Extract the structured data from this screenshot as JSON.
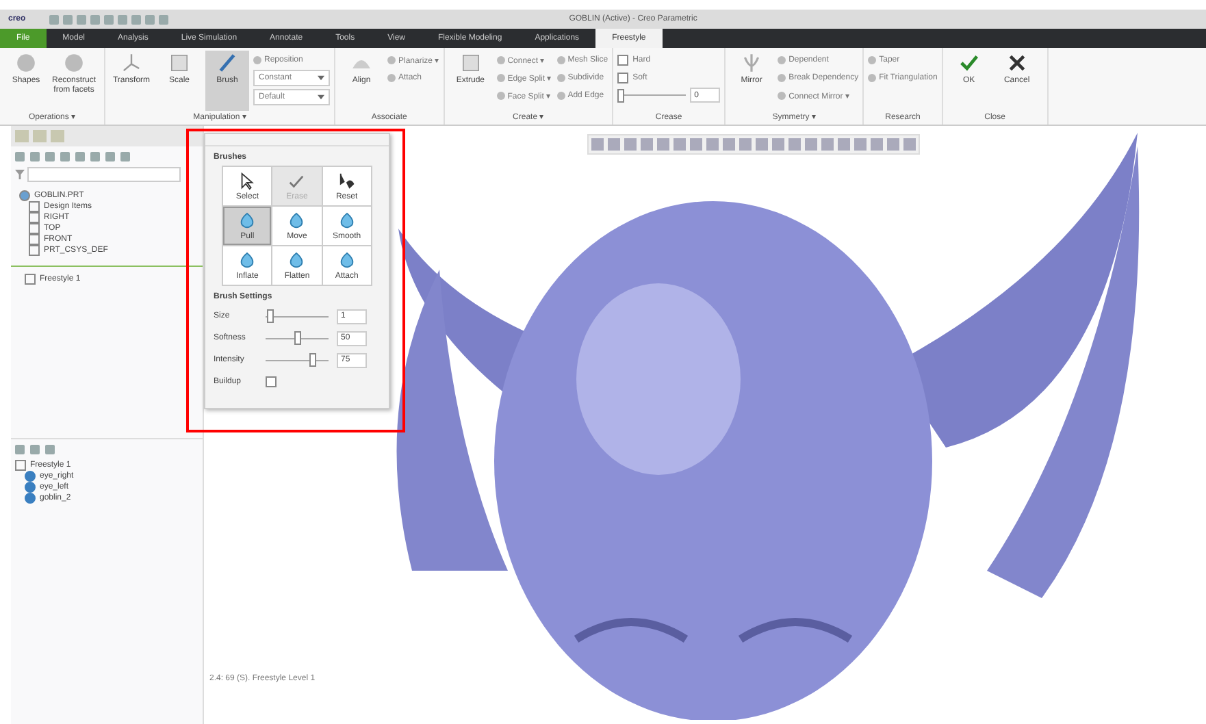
{
  "app": {
    "logo": "creo",
    "title": "GOBLIN (Active) - Creo Parametric"
  },
  "tabs": [
    {
      "label": "File",
      "selected": false
    },
    {
      "label": "Model",
      "selected": false
    },
    {
      "label": "Analysis",
      "selected": false
    },
    {
      "label": "Live Simulation",
      "selected": false
    },
    {
      "label": "Annotate",
      "selected": false
    },
    {
      "label": "Tools",
      "selected": false
    },
    {
      "label": "View",
      "selected": false
    },
    {
      "label": "Flexible Modeling",
      "selected": false
    },
    {
      "label": "Applications",
      "selected": false
    },
    {
      "label": "Freestyle",
      "selected": true
    }
  ],
  "ribbon": [
    {
      "label": "Operations ▾",
      "items": [
        {
          "kind": "large",
          "label": "Shapes",
          "selected": false
        },
        {
          "kind": "large",
          "label": "Reconstruct from facets",
          "selected": false
        }
      ]
    },
    {
      "label": "Manipulation ▾",
      "items": [
        {
          "kind": "large",
          "label": "Transform",
          "selected": false
        },
        {
          "kind": "large",
          "label": "Scale",
          "selected": false
        },
        {
          "kind": "large",
          "label": "Brush",
          "selected": true
        },
        {
          "kind": "small",
          "label": "Reposition"
        },
        {
          "kind": "dropdown",
          "label": "Constant"
        },
        {
          "kind": "dropdown",
          "label": "Default"
        }
      ]
    },
    {
      "label": "Associate",
      "items": [
        {
          "kind": "large",
          "label": "Align",
          "selected": false
        },
        {
          "kind": "small",
          "label": "Planarize ▾"
        },
        {
          "kind": "small",
          "label": "Attach"
        }
      ]
    },
    {
      "label": "Create ▾",
      "items": [
        {
          "kind": "large",
          "label": "Extrude",
          "selected": false
        },
        {
          "kind": "small",
          "label": "Connect ▾"
        },
        {
          "kind": "small",
          "label": "Edge Split ▾"
        },
        {
          "kind": "small",
          "label": "Face Split ▾"
        },
        {
          "kind": "small",
          "label": "Mesh Slice"
        },
        {
          "kind": "small",
          "label": "Subdivide"
        },
        {
          "kind": "small",
          "label": "Add Edge"
        }
      ]
    },
    {
      "label": "Crease",
      "items": [
        {
          "kind": "check",
          "label": "Hard",
          "checked": false
        },
        {
          "kind": "check",
          "label": "Soft",
          "checked": false
        },
        {
          "kind": "slider",
          "level": 0,
          "value": "0"
        }
      ]
    },
    {
      "label": "Symmetry ▾",
      "items": [
        {
          "kind": "large",
          "label": "Mirror",
          "selected": false
        },
        {
          "kind": "small",
          "label": "Dependent"
        },
        {
          "kind": "small",
          "label": "Break Dependency"
        },
        {
          "kind": "small",
          "label": "Connect Mirror ▾"
        }
      ]
    },
    {
      "label": "Research",
      "items": [
        {
          "kind": "small",
          "label": "Taper"
        },
        {
          "kind": "small",
          "label": "Fit Triangulation"
        }
      ]
    },
    {
      "label": "Close",
      "items": [
        {
          "kind": "large",
          "label": "OK",
          "selected": false
        },
        {
          "kind": "large",
          "label": "Cancel",
          "selected": false
        }
      ]
    }
  ],
  "model_tree": {
    "items": [
      {
        "label": "GOBLIN.PRT",
        "kind": "part"
      },
      {
        "label": "Design Items",
        "kind": "folder"
      },
      {
        "label": "RIGHT",
        "kind": "plane"
      },
      {
        "label": "TOP",
        "kind": "plane"
      },
      {
        "label": "FRONT",
        "kind": "plane"
      },
      {
        "label": "PRT_CSYS_DEF",
        "kind": "csys"
      }
    ],
    "insert_item": "Freestyle 1"
  },
  "shape_tree": {
    "label": "Freestyle 1",
    "children": [
      {
        "label": "eye_right"
      },
      {
        "label": "eye_left"
      },
      {
        "label": "goblin_2"
      }
    ]
  },
  "brushes": {
    "title": "Brushes",
    "tools": [
      {
        "label": "Select",
        "selected": false,
        "disabled": false
      },
      {
        "label": "Erase",
        "selected": false,
        "disabled": true
      },
      {
        "label": "Reset",
        "selected": false,
        "disabled": false
      },
      {
        "label": "Pull",
        "selected": true,
        "disabled": false
      },
      {
        "label": "Move",
        "selected": false,
        "disabled": false
      },
      {
        "label": "Smooth",
        "selected": false,
        "disabled": false
      },
      {
        "label": "Inflate",
        "selected": false,
        "disabled": false
      },
      {
        "label": "Flatten",
        "selected": false,
        "disabled": false
      },
      {
        "label": "Attach",
        "selected": false,
        "disabled": false
      }
    ],
    "settings_title": "Brush Settings",
    "settings": [
      {
        "label": "Size",
        "level": 0.02,
        "value": "1"
      },
      {
        "label": "Softness",
        "level": 0.5,
        "value": "50"
      },
      {
        "label": "Intensity",
        "level": 0.78,
        "value": "75"
      }
    ],
    "buildup": {
      "label": "Buildup",
      "checked": false
    }
  },
  "viewport": {
    "status": "2.4: 69 (S). Freestyle Level 1"
  }
}
